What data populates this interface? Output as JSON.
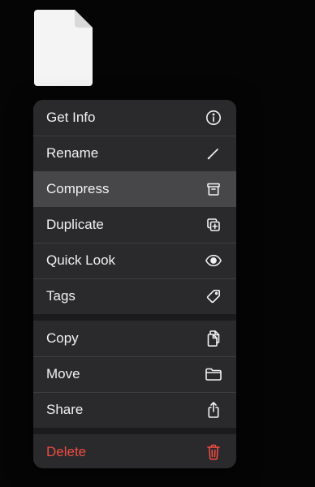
{
  "file": {
    "icon": "document-icon"
  },
  "menu": {
    "groups": [
      [
        {
          "label": "Get Info",
          "icon": "info-circle-icon"
        },
        {
          "label": "Rename",
          "icon": "pencil-icon"
        },
        {
          "label": "Compress",
          "icon": "archive-box-icon",
          "highlighted": true
        },
        {
          "label": "Duplicate",
          "icon": "duplicate-plus-icon"
        },
        {
          "label": "Quick Look",
          "icon": "eye-icon"
        },
        {
          "label": "Tags",
          "icon": "tag-icon"
        }
      ],
      [
        {
          "label": "Copy",
          "icon": "copy-docs-icon"
        },
        {
          "label": "Move",
          "icon": "folder-icon"
        },
        {
          "label": "Share",
          "icon": "share-icon"
        }
      ],
      [
        {
          "label": "Delete",
          "icon": "trash-icon",
          "destructive": true
        }
      ]
    ]
  },
  "colors": {
    "background": "#050505",
    "menu_background": "#2a2a2c",
    "highlight": "#47474a",
    "text": "#f2f2f2",
    "destructive": "#ef4b43"
  }
}
